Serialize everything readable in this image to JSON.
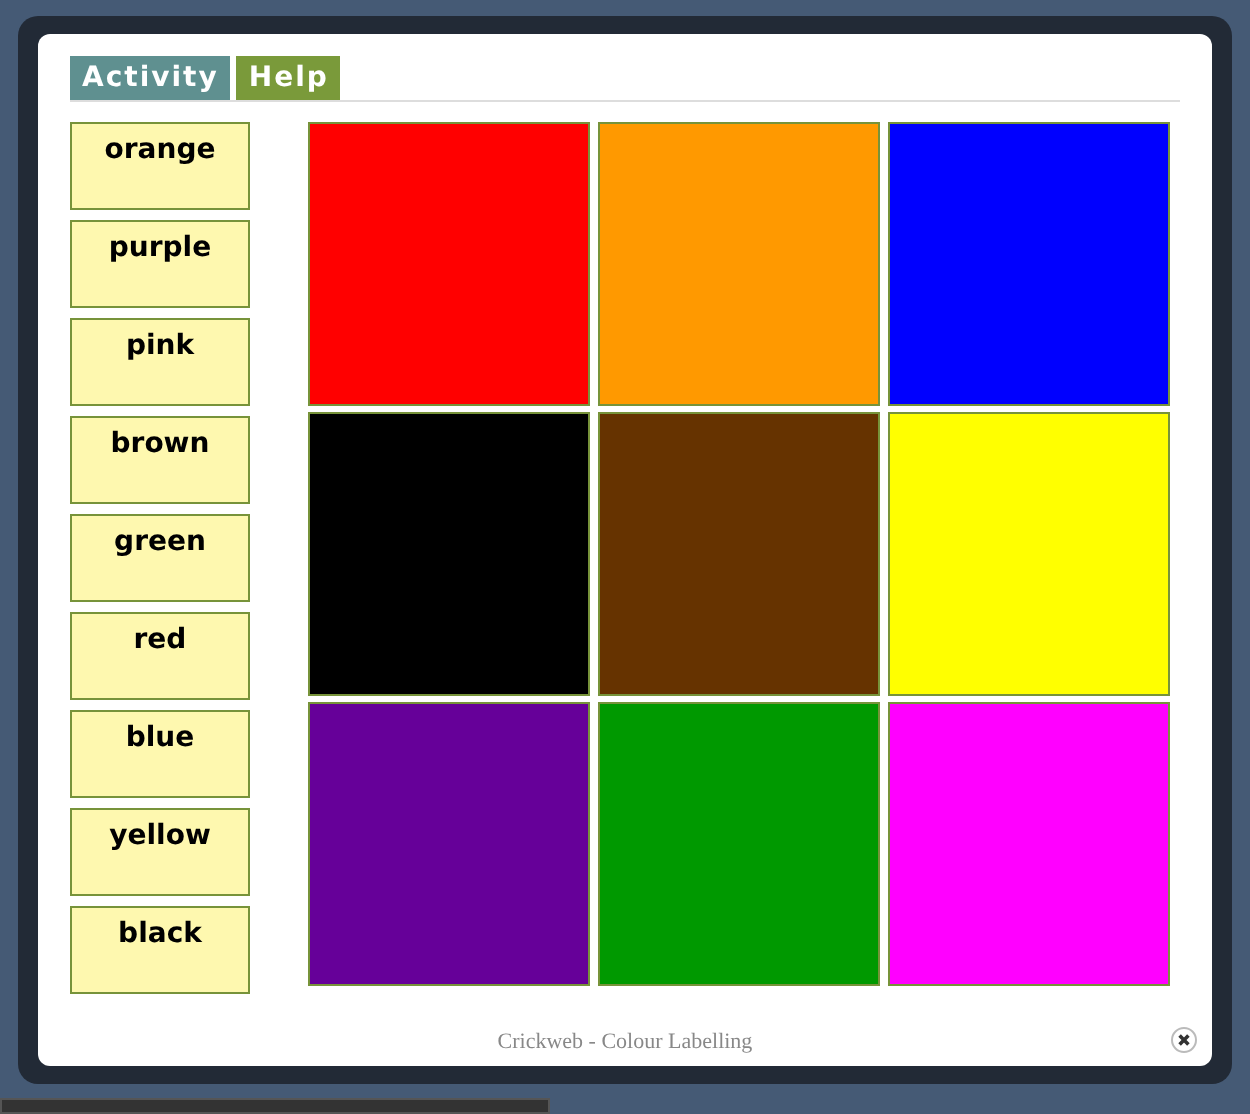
{
  "tabs": [
    {
      "label": "Activity",
      "color": "#5f9090"
    },
    {
      "label": "Help",
      "color": "#7a9a3a"
    }
  ],
  "labels": [
    "orange",
    "purple",
    "pink",
    "brown",
    "green",
    "red",
    "blue",
    "yellow",
    "black"
  ],
  "swatches": [
    {
      "color": "#ff0000"
    },
    {
      "color": "#ff9900"
    },
    {
      "color": "#0000ff"
    },
    {
      "color": "#000000"
    },
    {
      "color": "#663300"
    },
    {
      "color": "#ffff00"
    },
    {
      "color": "#660099"
    },
    {
      "color": "#009900"
    },
    {
      "color": "#ff00ff"
    }
  ],
  "footer": "Crickweb - Colour Labelling"
}
